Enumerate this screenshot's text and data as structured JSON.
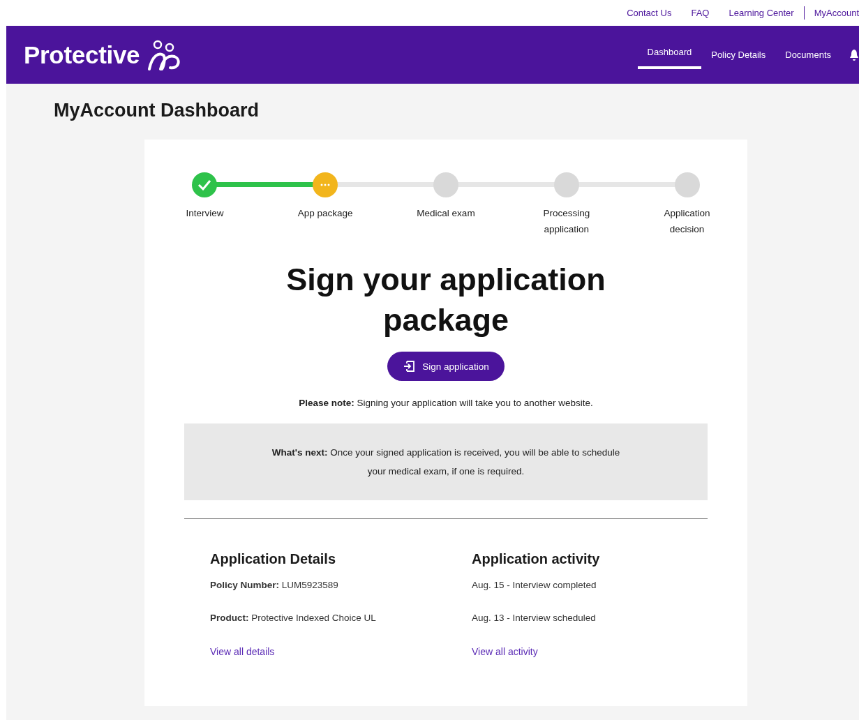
{
  "utility_links": [
    "Contact Us",
    "FAQ",
    "Learning Center",
    "MyAccount"
  ],
  "header": {
    "logo": "Protective",
    "nav": [
      {
        "label": "Dashboard",
        "selected": true
      },
      {
        "label": "Policy Details",
        "selected": false
      },
      {
        "label": "Documents",
        "selected": false
      }
    ]
  },
  "page_title": "MyAccount Dashboard",
  "steps": [
    {
      "label": "Interview",
      "kind": "done"
    },
    {
      "label": "App package",
      "kind": "current"
    },
    {
      "label": "Medical exam",
      "kind": "pending"
    },
    {
      "label": "Processing application",
      "kind": "pending"
    },
    {
      "label": "Application decision",
      "kind": "pending"
    }
  ],
  "heading": "Sign your application package",
  "sign_button": "Sign application",
  "note": "**Please note:** Signing your application will take you to another website.",
  "whats_next": "**What's next:** Once your signed application is received, you will be able to schedule your medical exam, if one is required.",
  "details": {
    "title": "Application Details",
    "lines": [
      "**Policy Number:** LUM5923589",
      "**Product:** Protective Indexed Choice UL"
    ],
    "link": "View all details"
  },
  "activity": {
    "title": "Application activity",
    "lines": [
      "Aug. 15  - Interview completed",
      "Aug. 13 - Interview scheduled"
    ],
    "link": "View all activity"
  }
}
